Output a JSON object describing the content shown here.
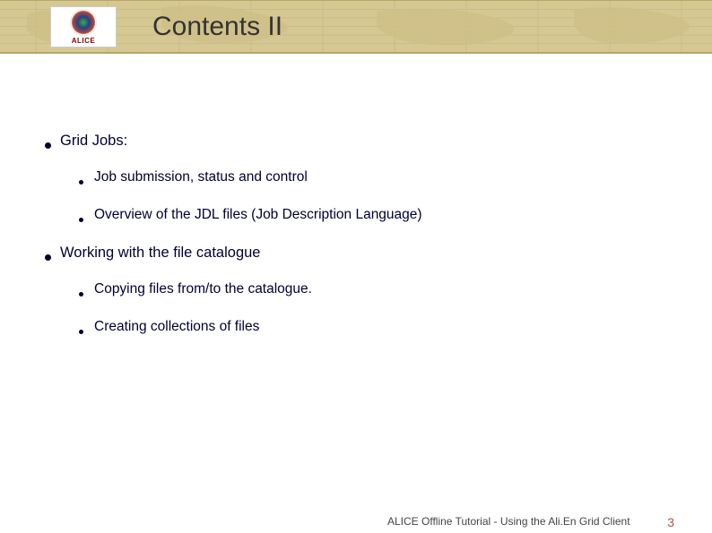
{
  "header": {
    "logo_label": "ALICE",
    "title": "Contents II"
  },
  "content": {
    "item1": {
      "label": "Grid Jobs:",
      "sub1": "Job submission, status and control",
      "sub2": "Overview of the JDL files (Job Description Language)"
    },
    "item2": {
      "label": "Working with the file catalogue",
      "sub1": "Copying files from/to the catalogue.",
      "sub2": "Creating collections of files"
    }
  },
  "footer": {
    "text": "ALICE Offline Tutorial - Using the Ali.En Grid Client",
    "page": "3"
  }
}
